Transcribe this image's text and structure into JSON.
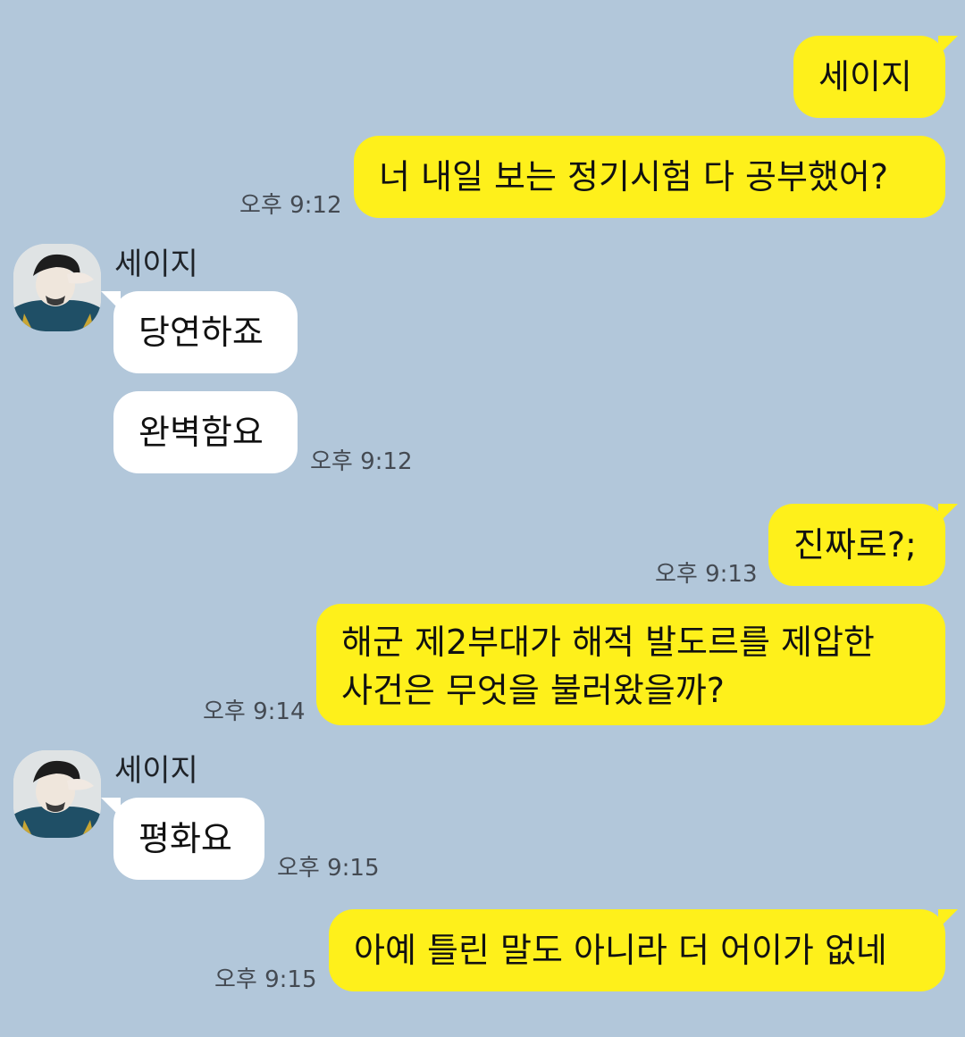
{
  "conversation": {
    "messages": [
      {
        "from": "me",
        "text": "세이지"
      },
      {
        "from": "me",
        "text": "너 내일 보는 정기시험 다 공부했어?",
        "time": "오후 9:12"
      },
      {
        "from": "them",
        "sender": "세이지",
        "text": "당연하죠"
      },
      {
        "from": "them",
        "text": "완벽함요",
        "time": "오후 9:12"
      },
      {
        "from": "me",
        "text": "진짜로?;",
        "time": "오후 9:13"
      },
      {
        "from": "me",
        "text_line1": "해군 제2부대가 해적 발도르를 제압한",
        "text_line2": "사건은 무엇을 불러왔을까?",
        "time": "오후 9:14"
      },
      {
        "from": "them",
        "sender": "세이지",
        "text": "평화요",
        "time": "오후 9:15"
      },
      {
        "from": "me",
        "text": "아예 틀린 말도 아니라 더 어이가 없네",
        "time": "오후 9:15"
      }
    ]
  },
  "colors": {
    "background": "#b2c7da",
    "my_bubble": "#fef01b",
    "their_bubble": "#ffffff"
  },
  "icons": {
    "avatar": "profile-avatar-icon"
  }
}
